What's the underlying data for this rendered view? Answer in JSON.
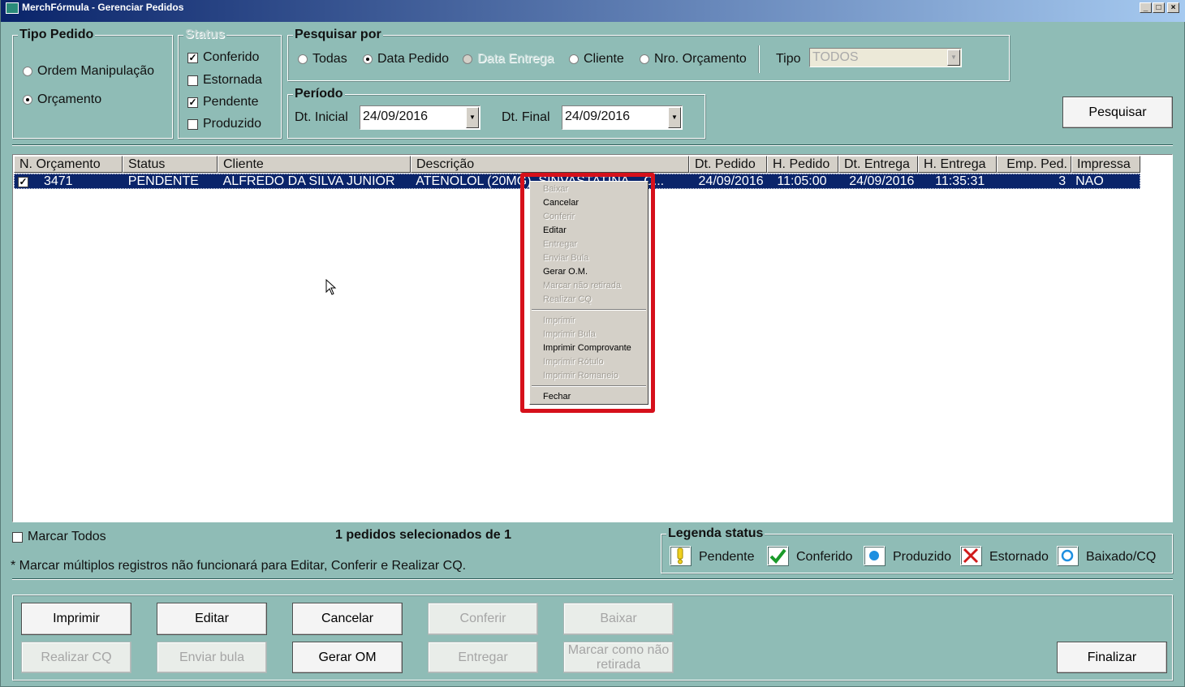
{
  "window": {
    "title": "MerchFórmula - Gerenciar Pedidos"
  },
  "tipo_pedido": {
    "label": "Tipo Pedido",
    "options": [
      "Ordem Manipulação",
      "Orçamento"
    ],
    "selected": "Orçamento"
  },
  "status": {
    "label": "Status",
    "items": [
      {
        "label": "Conferido",
        "checked": true
      },
      {
        "label": "Estornada",
        "checked": false
      },
      {
        "label": "Pendente",
        "checked": true
      },
      {
        "label": "Produzido",
        "checked": false
      }
    ]
  },
  "pesquisar_por": {
    "label": "Pesquisar por",
    "options": [
      "Todas",
      "Data Pedido",
      "Data Entrega",
      "Cliente",
      "Nro. Orçamento"
    ],
    "selected": "Data Pedido",
    "tipo_label": "Tipo",
    "tipo_value": "TODOS"
  },
  "periodo": {
    "label": "Período",
    "dt_inicial_label": "Dt. Inicial",
    "dt_inicial": "24/09/2016",
    "dt_final_label": "Dt. Final",
    "dt_final": "24/09/2016"
  },
  "search_button": "Pesquisar",
  "grid": {
    "columns": [
      "N. Orçamento",
      "Status",
      "Cliente",
      "Descrição",
      "Dt. Pedido",
      "H. Pedido",
      "Dt. Entrega",
      "H. Entrega",
      "Emp. Ped.",
      "Impressa"
    ],
    "rows": [
      {
        "numero": "3471",
        "status": "PENDENTE",
        "cliente": "ALFREDO DA SILVA JUNIOR",
        "descricao": "ATENOLOL (20MG), SINVASTATINA... C...",
        "dt_pedido": "24/09/2016",
        "h_pedido": "11:05:00",
        "dt_entrega": "24/09/2016",
        "h_entrega": "11:35:31",
        "emp_ped": "3",
        "impressa": "NAO"
      }
    ]
  },
  "context_menu": {
    "group1": [
      {
        "label": "Baixar",
        "enabled": false
      },
      {
        "label": "Cancelar",
        "enabled": true
      },
      {
        "label": "Conferir",
        "enabled": false
      },
      {
        "label": "Editar",
        "enabled": true
      },
      {
        "label": "Entregar",
        "enabled": false
      },
      {
        "label": "Enviar Bula",
        "enabled": false
      },
      {
        "label": "Gerar O.M.",
        "enabled": true
      },
      {
        "label": "Marcar não retirada",
        "enabled": false
      },
      {
        "label": "Realizar CQ",
        "enabled": false
      }
    ],
    "group2": [
      {
        "label": "Imprimir",
        "enabled": false
      },
      {
        "label": "Imprimir Bula",
        "enabled": false
      },
      {
        "label": "Imprimir Comprovante",
        "enabled": true
      },
      {
        "label": "Imprimir Rótulo",
        "enabled": false
      },
      {
        "label": "Imprimir Romaneio",
        "enabled": false
      }
    ],
    "group3": [
      {
        "label": "Fechar",
        "enabled": true
      }
    ]
  },
  "marcar_todos": "Marcar Todos",
  "selected_count": "1 pedidos selecionados de 1",
  "note": "* Marcar múltiplos registros não funcionará para Editar, Conferir e Realizar CQ.",
  "legenda": {
    "label": "Legenda status",
    "items": [
      {
        "label": "Pendente",
        "icon": "exclamation-icon",
        "color": "#f0d020"
      },
      {
        "label": "Conferido",
        "icon": "checkmark-icon",
        "color": "#1a9a2a"
      },
      {
        "label": "Produzido",
        "icon": "blue-dot-icon",
        "color": "#1e8fe0"
      },
      {
        "label": "Estornado",
        "icon": "red-x-icon",
        "color": "#d01a1a"
      },
      {
        "label": "Baixado/CQ",
        "icon": "blue-ring-icon",
        "color": "#1e8fe0"
      }
    ]
  },
  "actions": {
    "imprimir": "Imprimir",
    "editar": "Editar",
    "cancelar": "Cancelar",
    "conferir": "Conferir",
    "baixar": "Baixar",
    "realizar_cq": "Realizar CQ",
    "enviar_bula": "Enviar bula",
    "gerar_om": "Gerar OM",
    "entregar": "Entregar",
    "marcar_nao_retirada": "Marcar como não retirada",
    "finalizar": "Finalizar"
  }
}
